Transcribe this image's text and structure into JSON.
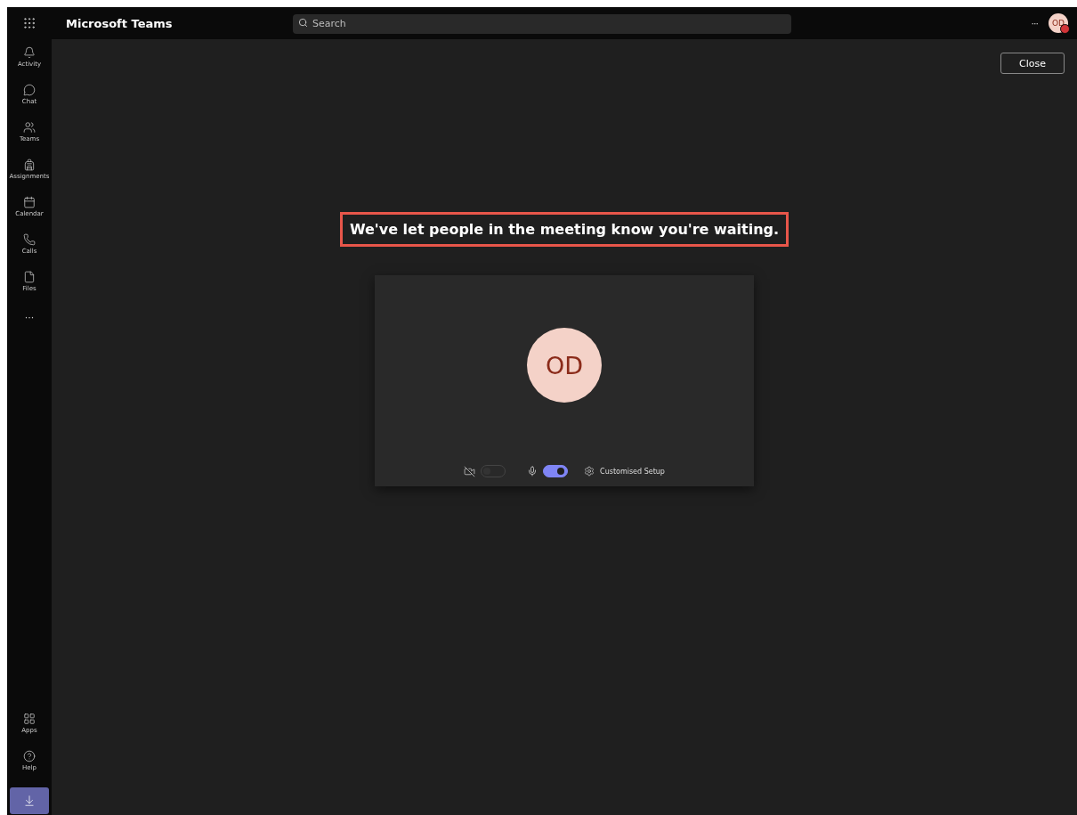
{
  "top_bar": {
    "app_title": "Microsoft Teams",
    "search": {
      "placeholder": "Search"
    },
    "more": "···",
    "avatar": {
      "initials": "OD",
      "color": "#d13438"
    }
  },
  "rail": {
    "items": [
      {
        "kind": "activity",
        "label": "Activity"
      },
      {
        "kind": "chat",
        "label": "Chat"
      },
      {
        "kind": "teams",
        "label": "Teams"
      },
      {
        "kind": "assignments",
        "label": "Assignments"
      },
      {
        "kind": "calendar",
        "label": "Calendar"
      },
      {
        "kind": "calls",
        "label": "Calls"
      },
      {
        "kind": "files",
        "label": "Files"
      }
    ],
    "more": "···",
    "bottom_items": [
      {
        "kind": "apps",
        "label": "Apps"
      },
      {
        "kind": "help",
        "label": "Help"
      }
    ]
  },
  "close_button": "Close",
  "message": "We've let people in the meeting know you're waiting.",
  "preview": {
    "initials": "OD",
    "camera_on": false,
    "mic_on": true,
    "setup": "Customised Setup"
  }
}
